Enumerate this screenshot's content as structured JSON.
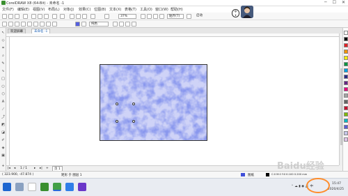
{
  "window": {
    "title": "CorelDRAW X8 (64-Bit) - 未命名 -1"
  },
  "menu": [
    "文件(F)",
    "编辑(E)",
    "视图(V)",
    "布局(L)",
    "对象(J)",
    "效果(C)",
    "位图(B)",
    "文本(X)",
    "表格(T)",
    "工具(O)",
    "窗口(W)",
    "帮助(H)"
  ],
  "toolbar": {
    "zoom_value": "37%",
    "snap_label": "贴齐(T)",
    "launch_label": "启动",
    "style_select": "纯色"
  },
  "tabs": [
    {
      "label": "欢迎屏幕"
    },
    {
      "label": "未命名 -1"
    }
  ],
  "pagebar": {
    "page_label": "页 1",
    "page_count": "1 / 1"
  },
  "statusbar": {
    "coords": "( 323.900, -47.874 )",
    "object_info": "矩形 于 图层 1",
    "fill_label": "图纸",
    "color_info": "C:0 M:0 Y:0 K:100  0.200 mm"
  },
  "taskbar": {
    "time": "15:47",
    "date": "2020/4/25"
  },
  "watermark": "Baidu经验",
  "colors": {
    "pattern_blue": "#3f4fd8",
    "pattern_light": "#c9cdf6",
    "accent": "#2a6ad8",
    "annotation": "#ff8c2a"
  },
  "palette": [
    "#ffffff",
    "#000000",
    "#e31e24",
    "#f39200",
    "#ffed00",
    "#009640",
    "#00a0e3",
    "#2b2a84",
    "#662483",
    "#e6007e",
    "#a3a3a3",
    "#646464",
    "#c8102e",
    "#7fba00",
    "#00b7c3",
    "#5b5bd6",
    "#c6c6e9",
    "#e0c3e8"
  ]
}
